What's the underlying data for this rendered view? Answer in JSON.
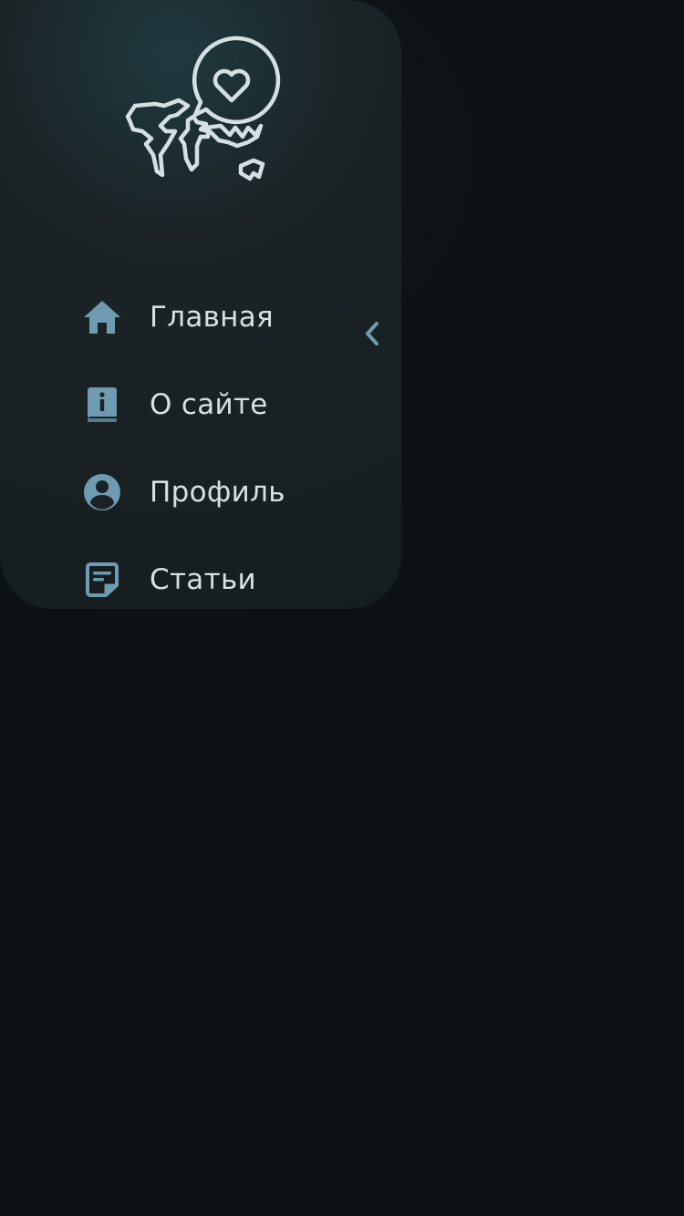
{
  "colors": {
    "icon_accent": "#6f9bb0",
    "logo_stroke": "#d4e0e4",
    "label_text": "#d9dfe2",
    "drawer_bg": "#1a2225",
    "page_bg": "#0d1215"
  },
  "logo": {
    "icon": "world-map-heart-bubble-icon"
  },
  "collapse": {
    "icon": "chevron-left-icon"
  },
  "nav": {
    "items": [
      {
        "label": "Главная",
        "icon": "home-icon"
      },
      {
        "label": "О сайте",
        "icon": "info-book-icon"
      },
      {
        "label": "Профиль",
        "icon": "user-circle-icon"
      },
      {
        "label": "Статьи",
        "icon": "article-note-icon"
      }
    ]
  }
}
